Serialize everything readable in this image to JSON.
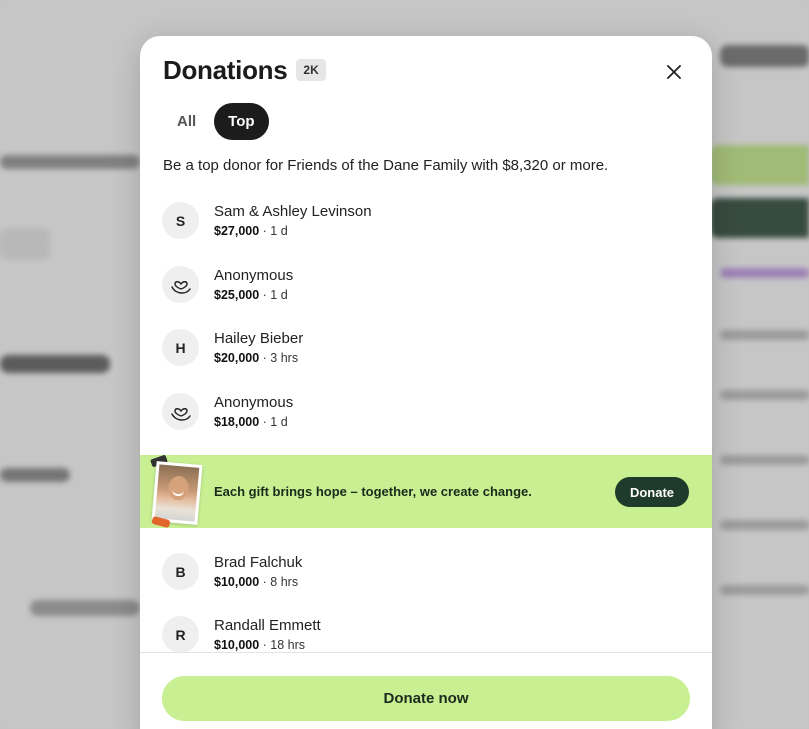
{
  "modal": {
    "title": "Donations",
    "count_badge": "2K",
    "close_icon": "close-icon"
  },
  "tabs": [
    {
      "label": "All",
      "active": false
    },
    {
      "label": "Top",
      "active": true
    }
  ],
  "intro_text": "Be a top donor for Friends of the Dane Family with $8,320 or more.",
  "donors": [
    {
      "avatar": "S",
      "avatar_type": "initial",
      "name": "Sam & Ashley Levinson",
      "amount": "$27,000",
      "time": "1 d"
    },
    {
      "avatar": "",
      "avatar_type": "heart-hand-icon",
      "name": "Anonymous",
      "amount": "$25,000",
      "time": "1 d"
    },
    {
      "avatar": "H",
      "avatar_type": "initial",
      "name": "Hailey Bieber",
      "amount": "$20,000",
      "time": "3 hrs"
    },
    {
      "avatar": "",
      "avatar_type": "heart-hand-icon",
      "name": "Anonymous",
      "amount": "$18,000",
      "time": "1 d"
    },
    {
      "avatar": "B",
      "avatar_type": "initial",
      "name": "Brad Falchuk",
      "amount": "$10,000",
      "time": "8 hrs"
    },
    {
      "avatar": "R",
      "avatar_type": "initial",
      "name": "Randall Emmett",
      "amount": "$10,000",
      "time": "18 hrs"
    }
  ],
  "meta_separator": " · ",
  "promo": {
    "text": "Each gift brings hope – together, we create change.",
    "button_label": "Donate"
  },
  "footer": {
    "button_label": "Donate now"
  },
  "colors": {
    "accent_green": "#c8f092",
    "dark_green": "#1f3b2a",
    "active_tab": "#1c1c1c"
  }
}
